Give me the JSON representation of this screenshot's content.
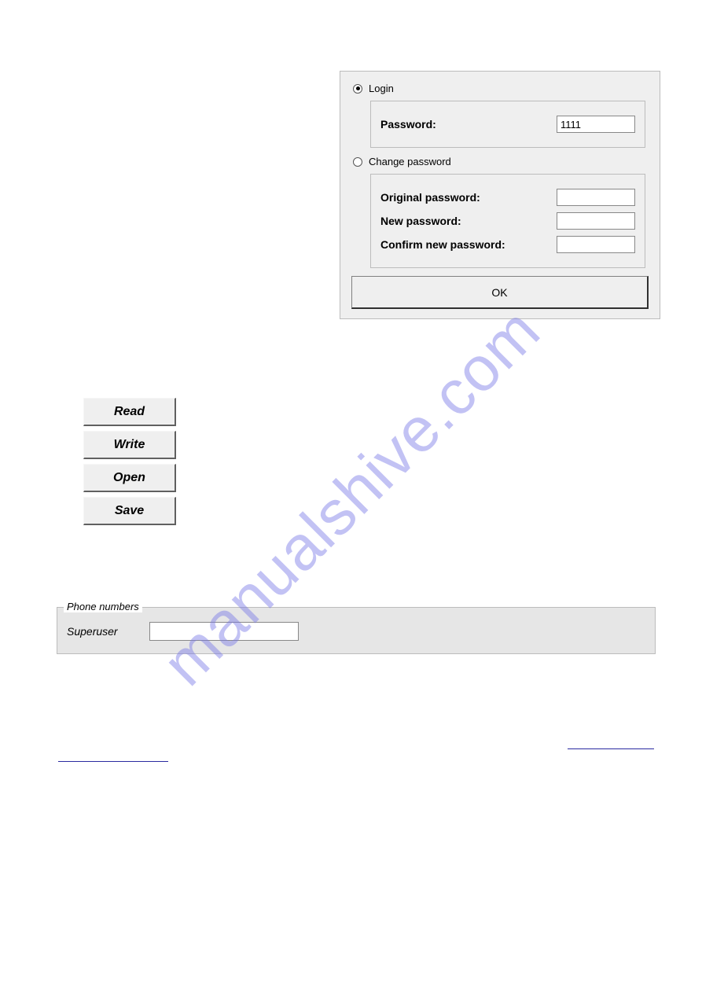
{
  "watermark": "manualshive.com",
  "login_dialog": {
    "radio_login_label": "Login",
    "radio_change_label": "Change password",
    "password_label": "Password:",
    "password_value": "1111",
    "original_password_label": "Original password:",
    "original_password_value": "",
    "new_password_label": "New password:",
    "new_password_value": "",
    "confirm_password_label": "Confirm new password:",
    "confirm_password_value": "",
    "ok_button": "OK"
  },
  "buttons": {
    "read": "Read",
    "write": "Write",
    "open": "Open",
    "save": "Save"
  },
  "phone_group": {
    "legend": "Phone numbers",
    "superuser_label": "Superuser",
    "superuser_value": ""
  }
}
